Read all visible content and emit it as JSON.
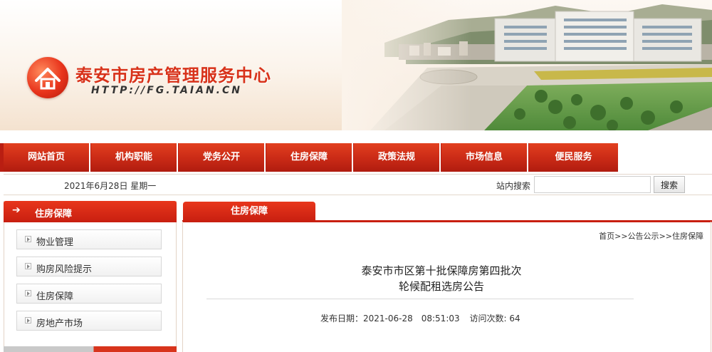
{
  "header": {
    "site_title": "泰安市房产管理服务中心",
    "site_url": "HTTP://FG.TAIAN.CN"
  },
  "nav": {
    "items": [
      "网站首页",
      "机构职能",
      "党务公开",
      "住房保障",
      "政策法规",
      "市场信息",
      "便民服务"
    ]
  },
  "infobar": {
    "date_text": "2021年6月28日 星期一",
    "search_label": "站内搜索",
    "search_value": "",
    "search_button": "搜索"
  },
  "sidebar": {
    "title": "住房保障",
    "arrow_icon": "right-arrow-icon",
    "items": [
      "物业管理",
      "购房风险提示",
      "住房保障",
      "房地产市场"
    ]
  },
  "main": {
    "tab_title": "住房保障",
    "breadcrumb": {
      "home": "首页",
      "sep1": ">>",
      "notice": "公告公示",
      "sep2": ">>",
      "current": "住房保障"
    },
    "article": {
      "title_line1": "泰安市市区第十批保障房第四批次",
      "title_line2": "轮候配租选房公告",
      "publish_label": "发布日期：2021-06-28　08:51:03",
      "visits_label": "访问次数: 64"
    }
  },
  "colors": {
    "brand_red": "#c81f10",
    "nav_red": "#e2401f",
    "title_red": "#d8321a"
  }
}
